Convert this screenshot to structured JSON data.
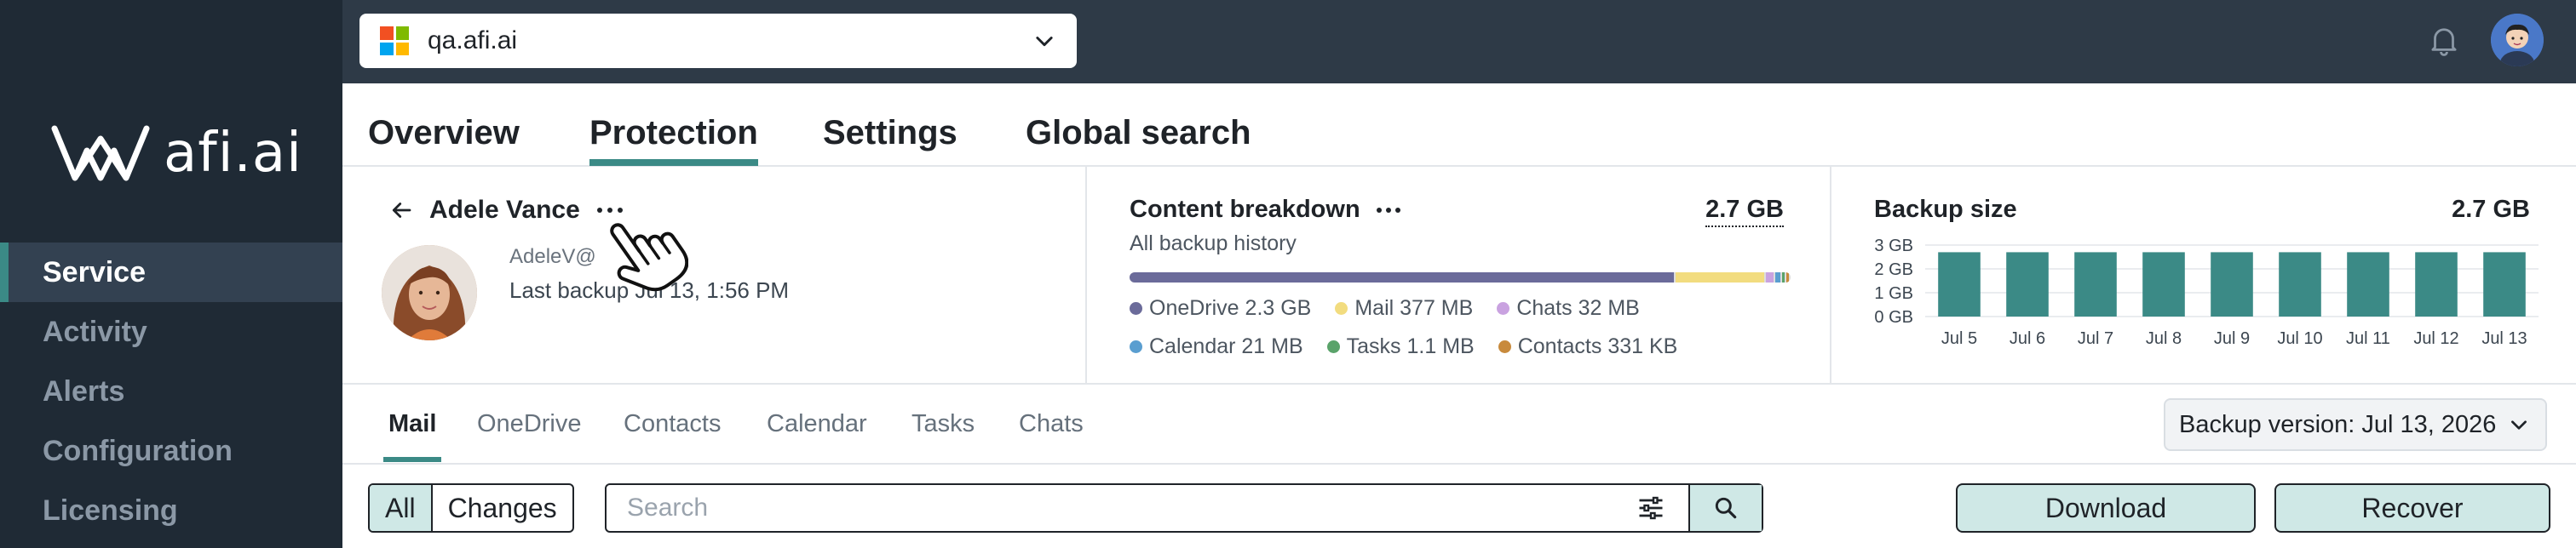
{
  "brand": {
    "logo_text": "afi.ai"
  },
  "sidebar": {
    "items": [
      {
        "label": "Service",
        "active": true
      },
      {
        "label": "Activity",
        "active": false
      },
      {
        "label": "Alerts",
        "active": false
      },
      {
        "label": "Configuration",
        "active": false
      },
      {
        "label": "Licensing",
        "active": false
      }
    ]
  },
  "topbar": {
    "tenant_name": "qa.afi.ai",
    "icons": {
      "tenant_logo": "microsoft-logo",
      "dropdown": "chevron-down-icon",
      "notifications": "bell-icon",
      "profile": "avatar"
    }
  },
  "main_tabs": [
    {
      "label": "Overview",
      "active": false
    },
    {
      "label": "Protection",
      "active": true
    },
    {
      "label": "Settings",
      "active": false
    },
    {
      "label": "Global search",
      "active": false
    }
  ],
  "user_card": {
    "name": "Adele Vance",
    "email": "AdeleV@",
    "last_backup": "Last backup Jul 13, 1:56 PM"
  },
  "content_breakdown": {
    "title": "Content breakdown",
    "subtitle": "All backup history",
    "total": "2.7 GB",
    "segments": [
      {
        "name": "OneDrive",
        "size": "2.3 GB",
        "value_mb": 2300,
        "color": "#6b6b9a"
      },
      {
        "name": "Mail",
        "size": "377 MB",
        "value_mb": 377,
        "color": "#f2dc7f"
      },
      {
        "name": "Chats",
        "size": "32 MB",
        "value_mb": 32,
        "color": "#c9a2e0"
      },
      {
        "name": "Calendar",
        "size": "21 MB",
        "value_mb": 21,
        "color": "#5a9ed0"
      },
      {
        "name": "Tasks",
        "size": "1.1 MB",
        "value_mb": 1.1,
        "color": "#5aa36a"
      },
      {
        "name": "Contacts",
        "size": "331 KB",
        "value_mb": 0.33,
        "color": "#c88a3c"
      }
    ]
  },
  "backup_size": {
    "title": "Backup size",
    "total": "2.7 GB"
  },
  "chart_data": {
    "type": "bar",
    "categories": [
      "Jul 5",
      "Jul 6",
      "Jul 7",
      "Jul 8",
      "Jul 9",
      "Jul 10",
      "Jul 11",
      "Jul 12",
      "Jul 13"
    ],
    "values": [
      2.7,
      2.7,
      2.7,
      2.7,
      2.7,
      2.7,
      2.7,
      2.7,
      2.7
    ],
    "yticks": [
      "0 GB",
      "1 GB",
      "2 GB",
      "3 GB"
    ],
    "ylim": [
      0,
      3
    ],
    "grid": true,
    "color": "#3b8a86"
  },
  "sub_tabs": [
    {
      "label": "Mail",
      "active": true
    },
    {
      "label": "OneDrive",
      "active": false
    },
    {
      "label": "Contacts",
      "active": false
    },
    {
      "label": "Calendar",
      "active": false
    },
    {
      "label": "Tasks",
      "active": false
    },
    {
      "label": "Chats",
      "active": false
    }
  ],
  "backup_version": "Backup version: Jul 13, 2026",
  "toolbar": {
    "seg_all": "All",
    "seg_changes": "Changes",
    "search_placeholder": "Search",
    "download_label": "Download",
    "recover_label": "Recover"
  },
  "colors": {
    "accent": "#3b8a86",
    "sidebar_bg": "#1f2a35",
    "topbar_bg": "#2e3a47",
    "button_bg": "#cfe8e6"
  }
}
